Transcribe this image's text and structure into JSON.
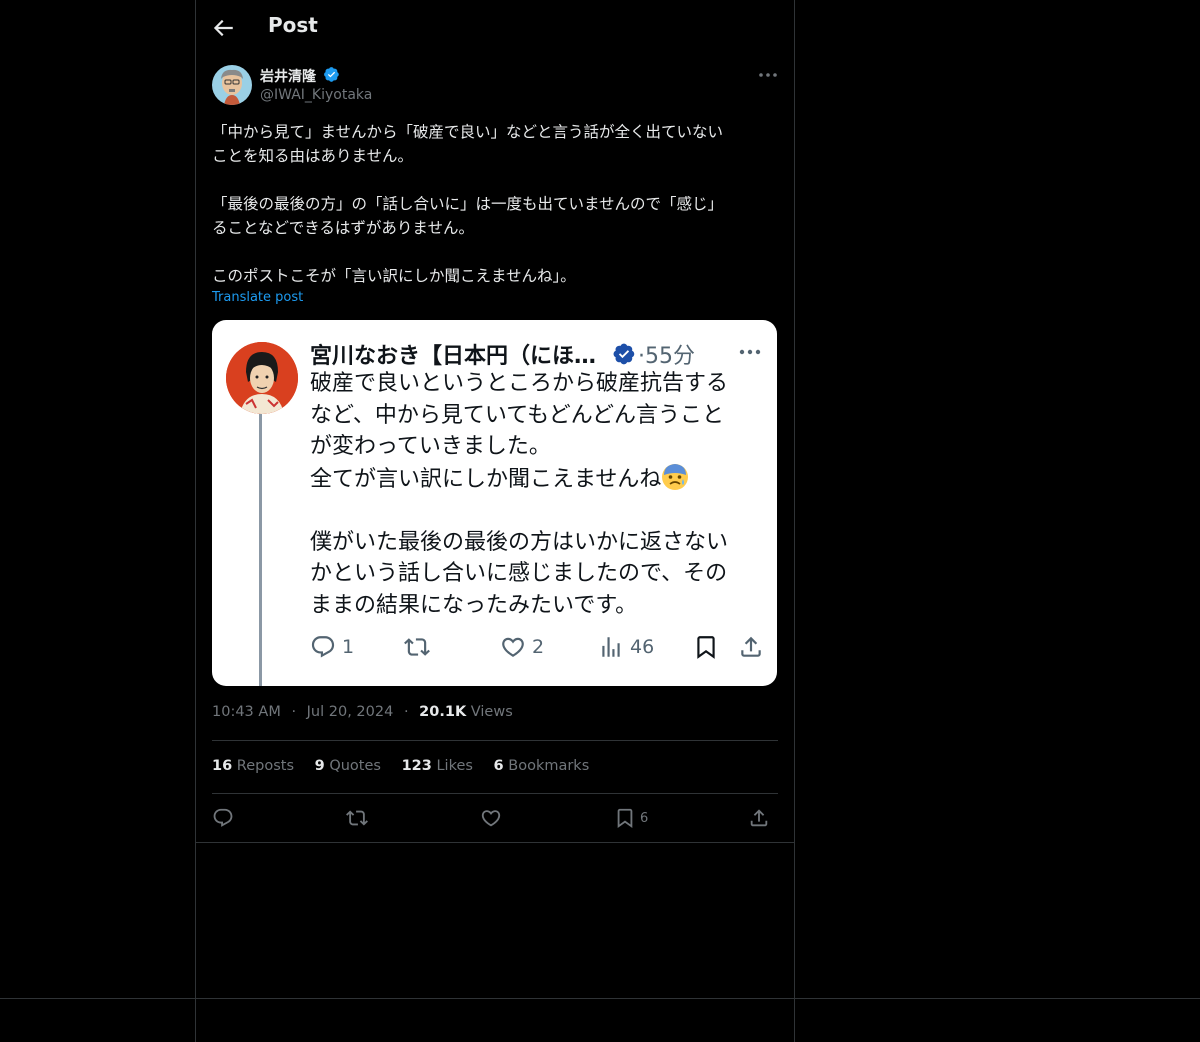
{
  "header": {
    "title": "Post"
  },
  "author": {
    "display_name": "岩井清隆",
    "handle": "@IWAI_Kiyotaka"
  },
  "tweet": {
    "paragraphs": [
      [
        "「中から見て」ませんから「破産で良い」などと言う話が全く出ていない",
        "ことを知る由はありません。"
      ],
      [
        "「最後の最後の方」の「話し合いに」は一度も出ていませんので「感じ」",
        "ることなどできるはずがありません。"
      ],
      [
        "このポストこそが「言い訳にしか聞こえませんね」。"
      ]
    ],
    "translate_label": "Translate post"
  },
  "embed": {
    "name": "宮川なおき【日本円（にほ…",
    "time": "·55分",
    "lines": [
      "破産で良いというところから破産抗告する",
      "など、中から見ていてもどんどん言うこと",
      "が変わっていきました。",
      "全てが言い訳にしか聞こえませんね",
      "",
      "僕がいた最後の最後の方はいかに返さない",
      "かという話し合いに感じましたので、その",
      "ままの結果になったみたいです。"
    ],
    "reply_count": "1",
    "like_count": "2",
    "view_count": "46"
  },
  "meta": {
    "time": "10:43 AM",
    "sep": "·",
    "date": "Jul 20, 2024",
    "views_count": "20.1K",
    "views_label": "Views"
  },
  "stats": {
    "reposts_count": "16",
    "reposts_label": "Reposts",
    "quotes_count": "9",
    "quotes_label": "Quotes",
    "likes_count": "123",
    "likes_label": "Likes",
    "bookmarks_count": "6",
    "bookmarks_label": "Bookmarks"
  },
  "actions": {
    "bookmark_count": "6"
  },
  "icons": [
    "back-arrow-icon",
    "verified-badge-icon",
    "more-icon",
    "reply-icon",
    "repost-icon",
    "like-icon",
    "views-icon",
    "bookmark-icon",
    "share-icon"
  ],
  "colors": {
    "background": "#000000",
    "text": "#e7e9ea",
    "muted": "#71767b",
    "accent": "#1d9bf0",
    "border": "#2f3336"
  }
}
